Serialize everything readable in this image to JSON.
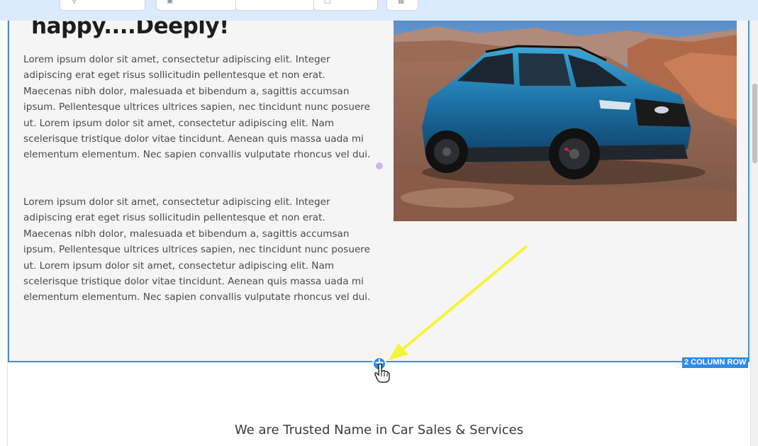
{
  "toolbar": {
    "icons": [
      "search-icon",
      "document-icon",
      "file-icon",
      "grid-icon"
    ]
  },
  "row": {
    "heading": "happy....Deeply!",
    "paragraphs": [
      "Lorem ipsum dolor sit amet, consectetur adipiscing elit. Integer adipiscing erat eget risus sollicitudin pellentesque et non erat. Maecenas nibh dolor, malesuada et bibendum a, sagittis accumsan ipsum. Pellentesque ultrices ultrices sapien, nec tincidunt nunc posuere ut. Lorem ipsum dolor sit amet, consectetur adipiscing elit. Nam scelerisque tristique dolor vitae tincidunt. Aenean quis massa uada mi elementum elementum. Nec sapien convallis vulputate rhoncus vel dui.",
      "Lorem ipsum dolor sit amet, consectetur adipiscing elit. Integer adipiscing erat eget risus sollicitudin pellentesque et non erat. Maecenas nibh dolor, malesuada et bibendum a, sagittis accumsan ipsum. Pellentesque ultrices ultrices sapien, nec tincidunt nunc posuere ut. Lorem ipsum dolor sit amet, consectetur adipiscing elit. Nam scelerisque tristique dolor vitae tincidunt. Aenean quis massa uada mi elementum elementum. Nec sapien convallis vulputate rhoncus vel dui."
    ],
    "badge": "2 COLUMN ROW"
  },
  "add_button": {
    "symbol": "+"
  },
  "section": {
    "title": "We are Trusted Name in Car Sales & Services"
  },
  "colors": {
    "accent": "#2f8ae8",
    "toolbar_bg": "#dbeafd",
    "row_bg": "#f5f5f5",
    "arrow": "#f4f43a"
  }
}
